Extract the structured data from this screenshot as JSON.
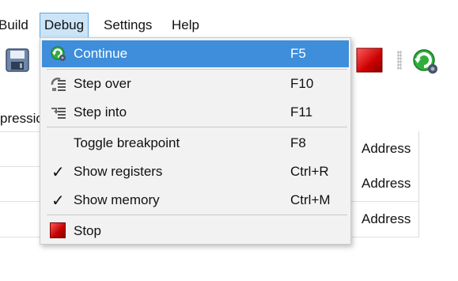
{
  "menubar": {
    "items": [
      {
        "label": "Build"
      },
      {
        "label": "Debug"
      },
      {
        "label": "Settings"
      },
      {
        "label": "Help"
      }
    ]
  },
  "toolbar": {
    "icons": [
      "save-icon",
      "stop-icon",
      "continue-icon"
    ]
  },
  "table": {
    "partial_header": "pressio",
    "address_cells": [
      "Address",
      "Address",
      "Address"
    ]
  },
  "debug_menu": {
    "items": [
      {
        "label": "Continue",
        "shortcut": "F5",
        "icon": "continue-icon",
        "highlighted": true
      },
      {
        "label": "Step over",
        "shortcut": "F10",
        "icon": "step-over-icon"
      },
      {
        "label": "Step into",
        "shortcut": "F11",
        "icon": "step-into-icon"
      },
      {
        "label": "Toggle breakpoint",
        "shortcut": "F8",
        "icon": ""
      },
      {
        "label": "Show registers",
        "shortcut": "Ctrl+R",
        "checked": true
      },
      {
        "label": "Show memory",
        "shortcut": "Ctrl+M",
        "checked": true
      },
      {
        "label": "Stop",
        "shortcut": "",
        "icon": "stop-icon"
      }
    ]
  },
  "colors": {
    "highlight": "#3e8edb",
    "menu_bg": "#f2f2f2",
    "active_menu_bg": "#cce4f7",
    "stop_red": "#cc0000"
  }
}
